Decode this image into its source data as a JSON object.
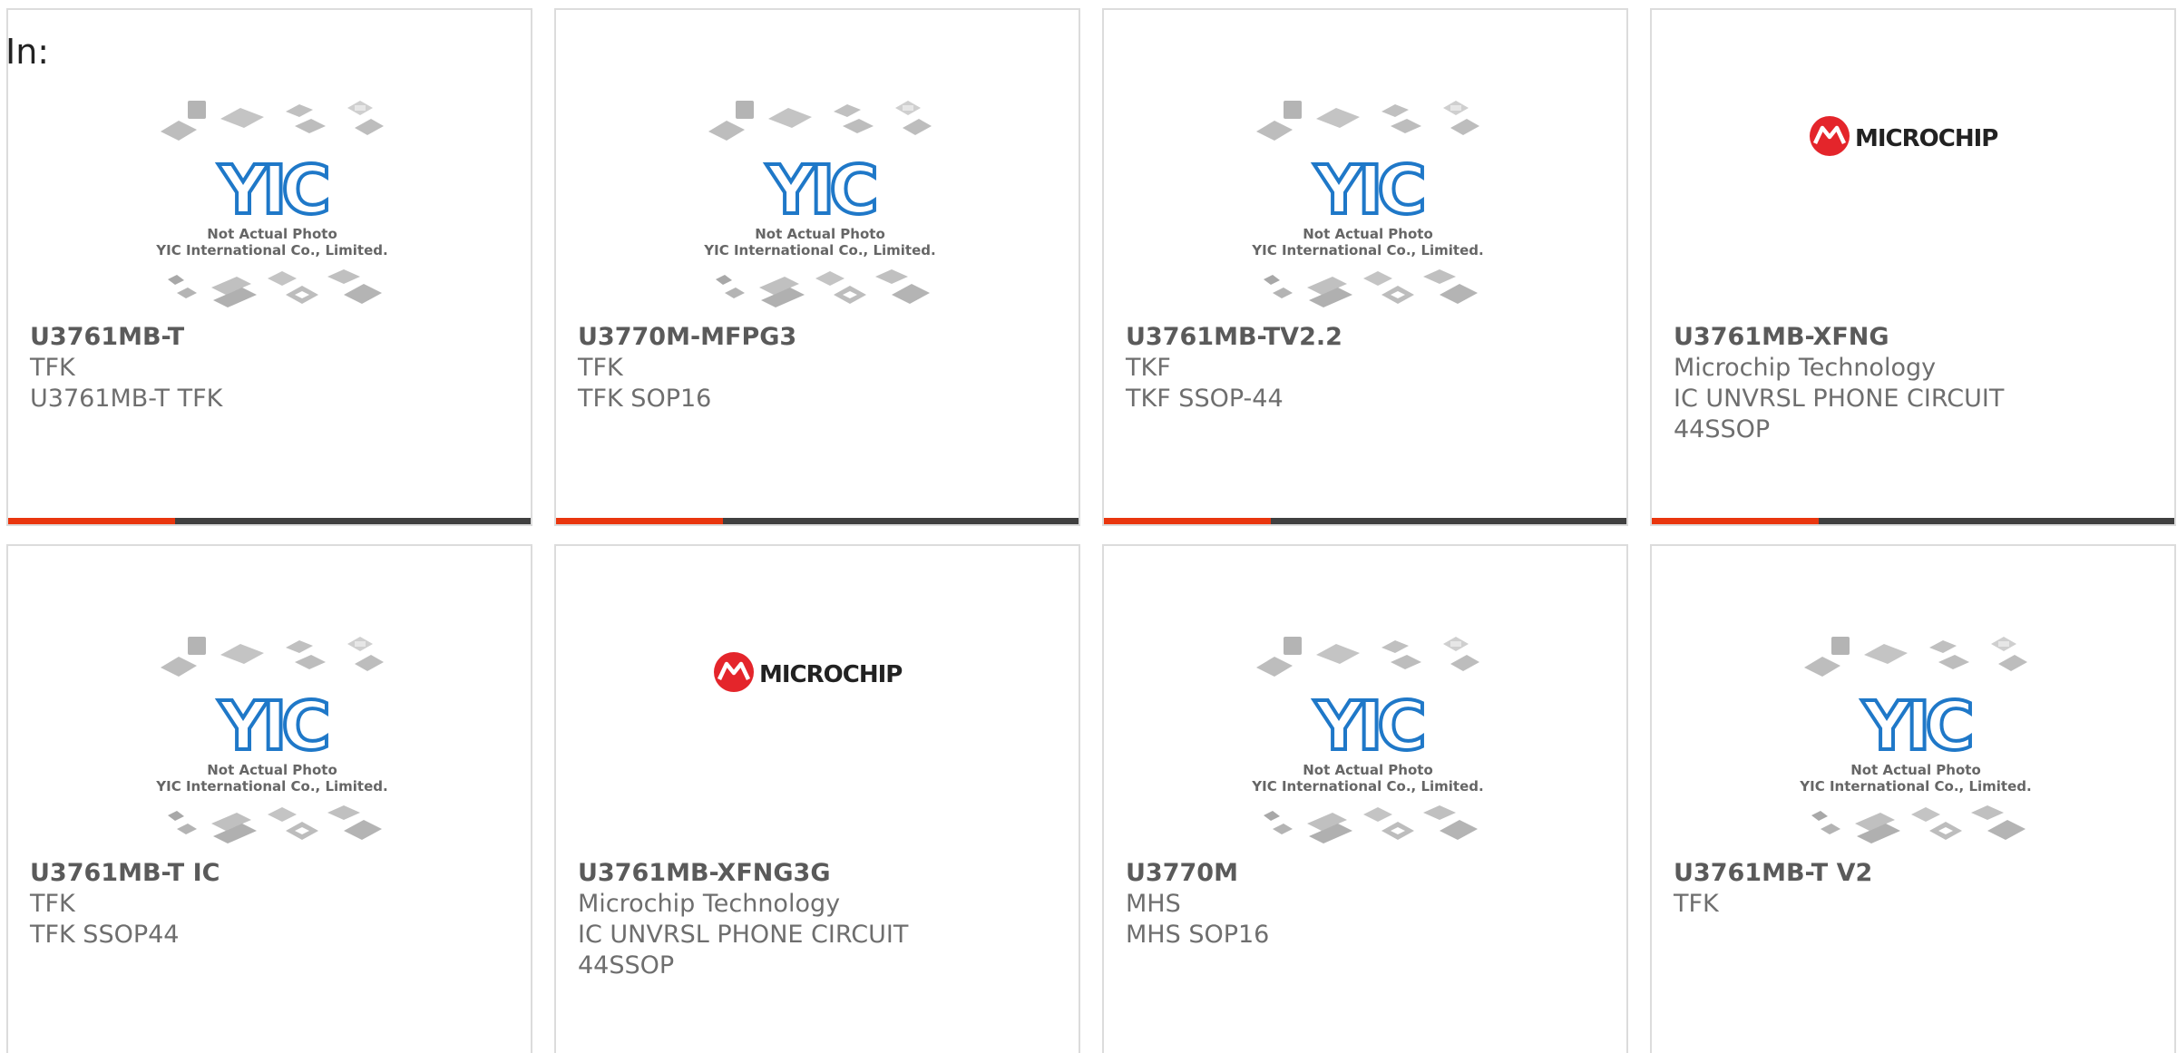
{
  "header": {
    "in_label": "In:"
  },
  "placeholder_image": {
    "caption_line1": "Not Actual Photo",
    "caption_line2": "YIC International Co., Limited.",
    "logo_text": "YIC"
  },
  "microchip_logo": {
    "text": "MICROCHIP"
  },
  "colors": {
    "accent": "#e9360e",
    "bar_dark": "#404040",
    "yic_blue": "#1f78c8",
    "microchip_red": "#e4252b",
    "text_gray": "#6e6e6e"
  },
  "products": [
    {
      "part": "U3761MB-T",
      "mfr": "TFK",
      "desc1": "U3761MB-T TFK",
      "desc2": "",
      "image": "yic-placeholder"
    },
    {
      "part": "U3770M-MFPG3",
      "mfr": "TFK",
      "desc1": "TFK SOP16",
      "desc2": "",
      "image": "yic-placeholder"
    },
    {
      "part": "U3761MB-TV2.2",
      "mfr": "TKF",
      "desc1": "TKF SSOP-44",
      "desc2": "",
      "image": "yic-placeholder"
    },
    {
      "part": "U3761MB-XFNG",
      "mfr": "Microchip Technology",
      "desc1": "IC UNVRSL PHONE CIRCUIT",
      "desc2": "44SSOP",
      "image": "microchip-logo"
    },
    {
      "part": "U3761MB-T IC",
      "mfr": "TFK",
      "desc1": "TFK SSOP44",
      "desc2": "",
      "image": "yic-placeholder"
    },
    {
      "part": "U3761MB-XFNG3G",
      "mfr": "Microchip Technology",
      "desc1": "IC UNVRSL PHONE CIRCUIT",
      "desc2": "44SSOP",
      "image": "microchip-logo"
    },
    {
      "part": "U3770M",
      "mfr": "MHS",
      "desc1": "MHS SOP16",
      "desc2": "",
      "image": "yic-placeholder"
    },
    {
      "part": "U3761MB-T V2",
      "mfr": "TFK",
      "desc1": "",
      "desc2": "",
      "image": "yic-placeholder"
    }
  ]
}
